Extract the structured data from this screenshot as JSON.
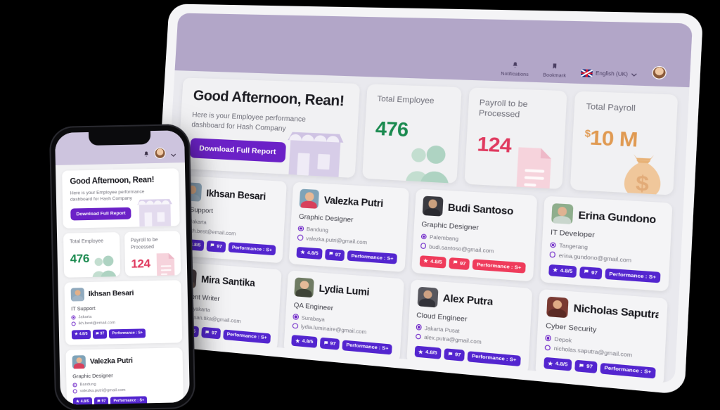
{
  "header": {
    "notifications_label": "Notifications",
    "notifications_icon": "bell-icon",
    "bookmark_label": "Bookmark",
    "bookmark_icon": "bookmark-icon",
    "language_label": "English (UK)",
    "language_flag": "uk-flag-icon",
    "chevron_icon": "chevron-down-icon",
    "avatar_icon": "avatar"
  },
  "greeting": {
    "title": "Good Afternoon, Rean!",
    "subtitle": "Here is your Employee performance dashboard for Hash Company",
    "button_label": "Download Full Report",
    "illustration": "storefront-illustration"
  },
  "stats": [
    {
      "label": "Total Employee",
      "value": "476",
      "currency": "",
      "color": "#1a8a4f",
      "icon": "people-icon",
      "icon_color": "#c3ded0"
    },
    {
      "label": "Payroll to be Processed",
      "value": "124",
      "currency": "",
      "color": "#e03a5f",
      "icon": "document-icon",
      "icon_color": "#f6d3dc"
    },
    {
      "label": "Total Payroll",
      "value": "10 M",
      "currency": "$",
      "color": "#e09a52",
      "icon": "money-bag-icon",
      "icon_color": "#f0c79b"
    }
  ],
  "employees": [
    {
      "name": "Ikhsan Besari",
      "role": "IT Support",
      "city": "Jakarta",
      "email": "ikh.best@email.com",
      "rating": "4.8/5",
      "comments": "97",
      "performance": "Performance : S+",
      "badge_color": "purple",
      "photo_bg": "#8fa9bd",
      "skin": "#e3b089",
      "shirt": "#9fb4c6"
    },
    {
      "name": "Valezka Putri",
      "role": "Graphic Designer",
      "city": "Bandung",
      "email": "valezka.putri@gmail.com",
      "rating": "4.8/5",
      "comments": "97",
      "performance": "Performance : S+",
      "badge_color": "purple",
      "photo_bg": "#7fa3b8",
      "skin": "#e8b894",
      "shirt": "#d8405c"
    },
    {
      "name": "Budi Santoso",
      "role": "Graphic Designer",
      "city": "Palembang",
      "email": "budi.santoso@gmail.com",
      "rating": "4.8/5",
      "comments": "97",
      "performance": "Performance : S+",
      "badge_color": "red",
      "photo_bg": "#3a3a40",
      "skin": "#caa07e",
      "shirt": "#2a2a30"
    },
    {
      "name": "Erina Gundono",
      "role": "IT Developer",
      "city": "Tangerang",
      "email": "erina.gundono@gmail.com",
      "rating": "4.8/5",
      "comments": "97",
      "performance": "Performance : S+",
      "badge_color": "purple",
      "photo_bg": "#8fae8d",
      "skin": "#e0b392",
      "shirt": "#c9d6cd"
    },
    {
      "name": "Mira Santika",
      "role": "Content Writer",
      "city": "Yogyakarta",
      "email": "mirasan.tika@gmail.com",
      "rating": "4.8/5",
      "comments": "97",
      "performance": "Performance : S+",
      "badge_color": "purple",
      "photo_bg": "#4b3f43",
      "skin": "#dcab88",
      "shirt": "#6c5a52"
    },
    {
      "name": "Lydia Lumi",
      "role": "QA Engineer",
      "city": "Surabaya",
      "email": "lydia.luminaire@gmail.com",
      "rating": "4.8/5",
      "comments": "97",
      "performance": "Performance : S+",
      "badge_color": "purple",
      "photo_bg": "#6f7b63",
      "skin": "#e4ba98",
      "shirt": "#3f4438"
    },
    {
      "name": "Alex Putra",
      "role": "Cloud Engineer",
      "city": "Jakarta Pusat",
      "email": "alex.putra@gmail.com",
      "rating": "4.8/5",
      "comments": "97",
      "performance": "Performance : S+",
      "badge_color": "purple",
      "photo_bg": "#57575e",
      "skin": "#cda182",
      "shirt": "#33333a"
    },
    {
      "name": "Nicholas Saputra",
      "role": "Cyber Security",
      "city": "Depok",
      "email": "nicholas.saputra@gmail.com",
      "rating": "4.8/5",
      "comments": "97",
      "performance": "Performance : S+",
      "badge_color": "purple",
      "photo_bg": "#7a3a32",
      "skin": "#e0ab85",
      "shirt": "#5a2a24"
    }
  ],
  "icons": {
    "star": "★",
    "comment": "ὊC",
    "bell": "🔔",
    "bookmark": "🔖",
    "chevron": "⌄"
  },
  "phone": {
    "greeting_title": "Good Afternoon, Rean!",
    "greeting_subtitle": "Here is your Employee performance dashboard for Hash Company",
    "download_label": "Download Full Report",
    "stats": [
      {
        "label": "Total Employee",
        "value": "476",
        "color": "#1a8a4f"
      },
      {
        "label": "Payroll to be Processed",
        "value": "124",
        "color": "#e03a5f"
      }
    ],
    "employees": [
      {
        "name": "Ikhsan Besari",
        "role": "IT Support",
        "city": "Jakarta",
        "email": "ikh.best@email.com",
        "rating": "4.8/5",
        "comments": "97",
        "performance": "Performance : S+"
      },
      {
        "name": "Valezka Putri",
        "role": "Graphic Designer",
        "city": "Bandung",
        "email": "valezka.putri@gmail.com",
        "rating": "4.8/5",
        "comments": "97",
        "performance": "Performance : S+"
      }
    ]
  },
  "theme": {
    "accent": "#6b21c7",
    "badge": "#5325cf",
    "badge_red": "#ef3b5b",
    "header_band": "#b2a6c8",
    "phone_band": "#cdc4de"
  }
}
